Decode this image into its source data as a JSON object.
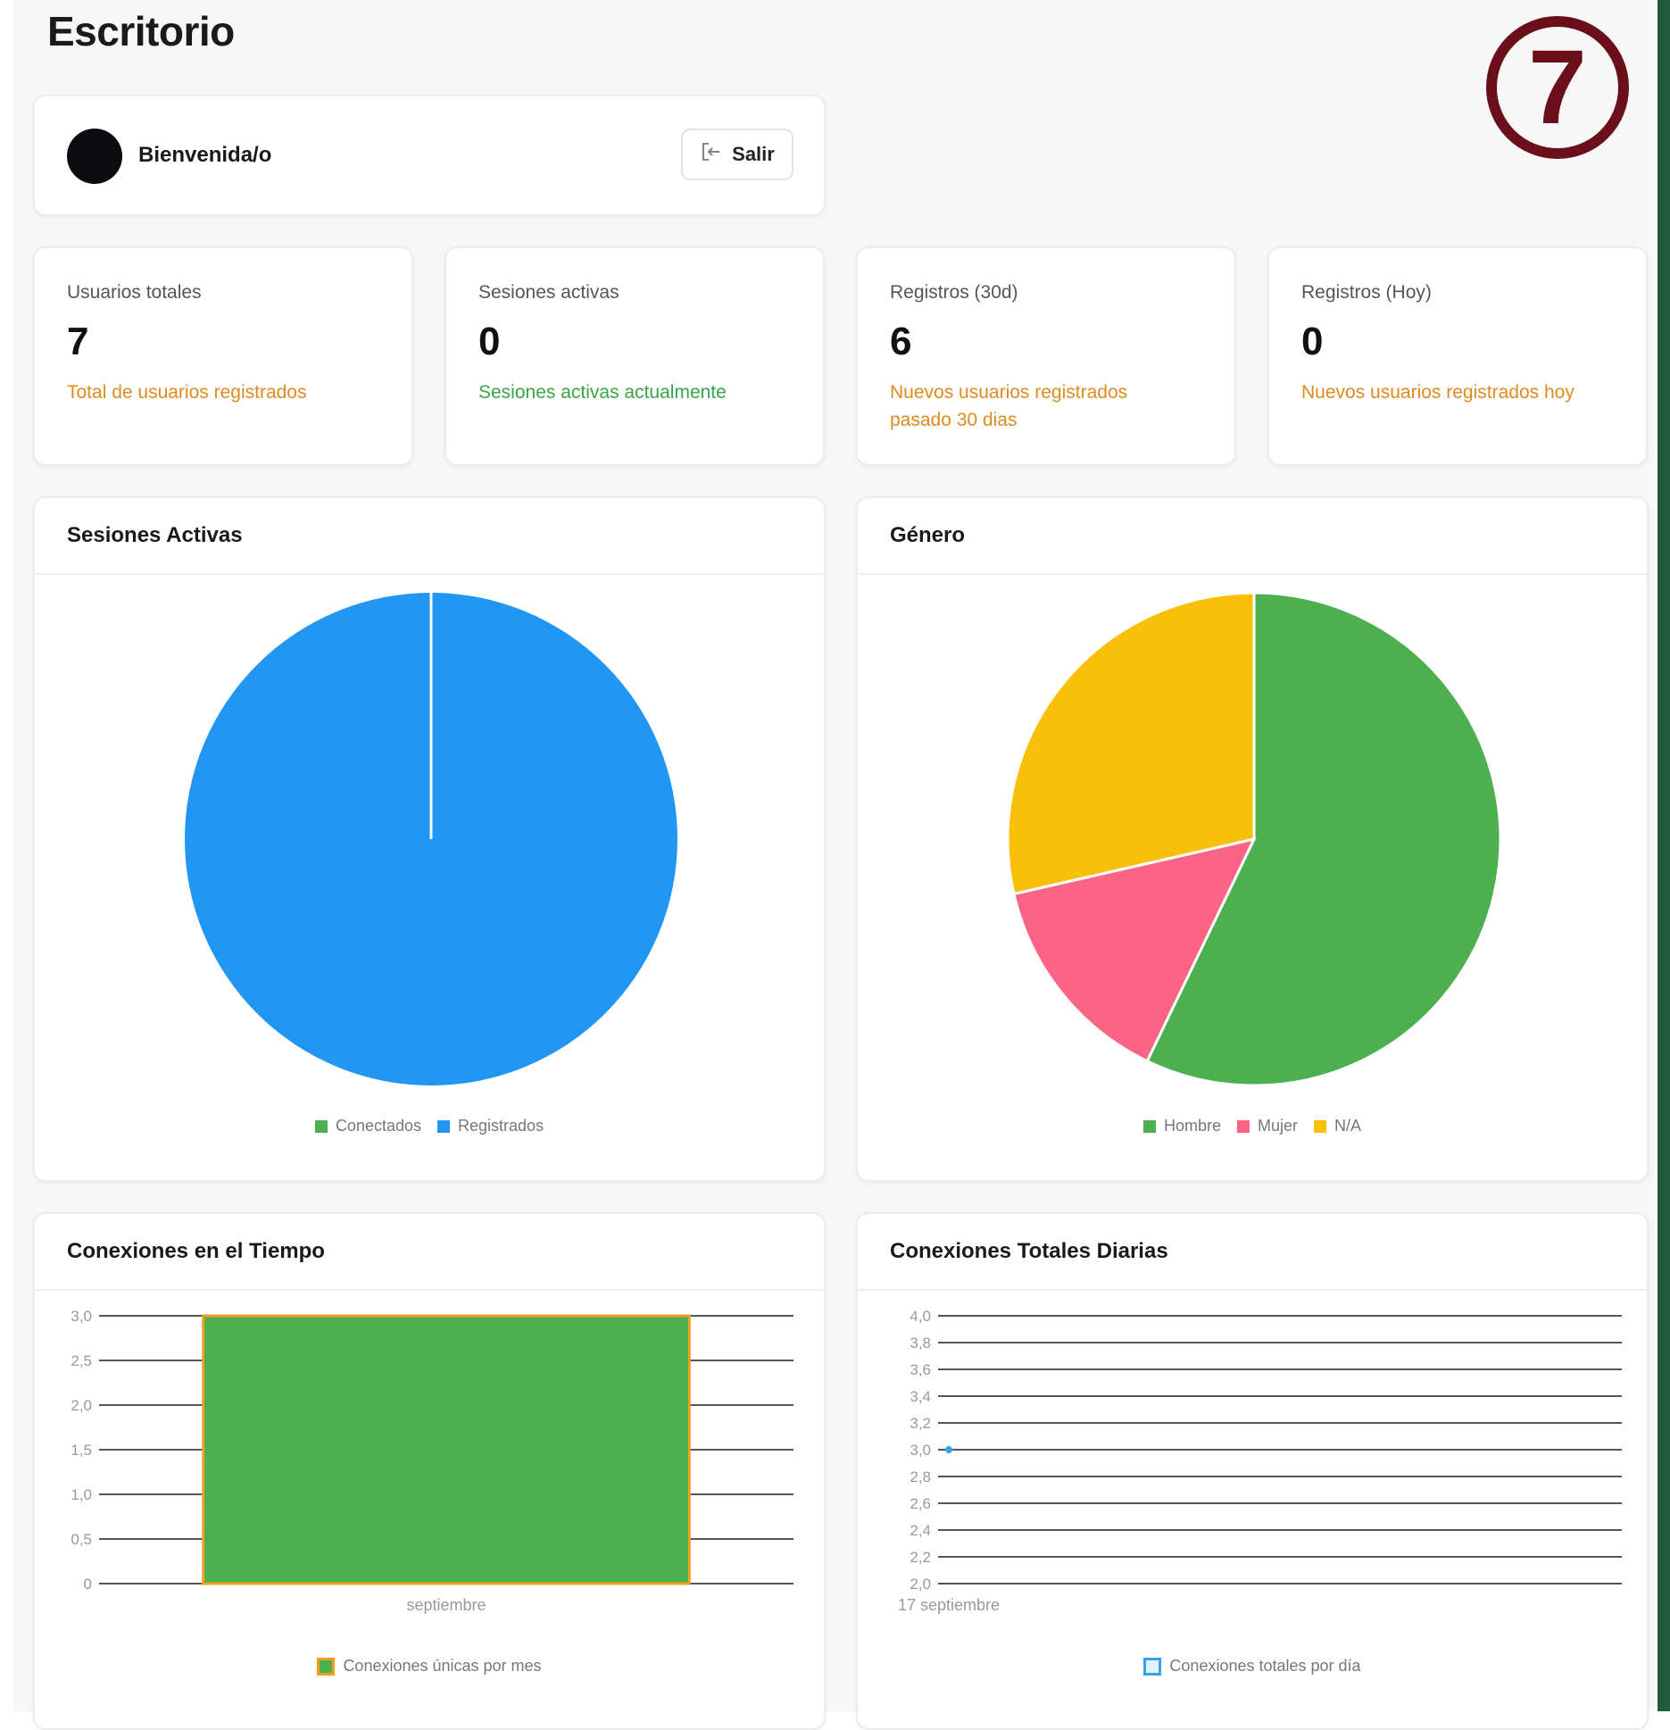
{
  "page": {
    "title": "Escritorio",
    "badge": "7"
  },
  "welcome": {
    "greeting": "Bienvenida/o",
    "logout_label": "Salir"
  },
  "stats": [
    {
      "label": "Usuarios totales",
      "value": "7",
      "subtitle": "Total de usuarios registrados",
      "color": "#e08a1e"
    },
    {
      "label": "Sesiones activas",
      "value": "0",
      "subtitle": "Sesiones activas actualmente",
      "color": "#3aa34a"
    },
    {
      "label": "Registros (30d)",
      "value": "6",
      "subtitle": "Nuevos usuarios registrados pasado 30 dias",
      "color": "#e08a1e"
    },
    {
      "label": "Registros (Hoy)",
      "value": "0",
      "subtitle": "Nuevos usuarios registrados hoy",
      "color": "#e08a1e"
    }
  ],
  "panels": {
    "sessions_title": "Sesiones Activas",
    "gender_title": "Género",
    "connections_title": "Conexiones en el Tiempo",
    "daily_title": "Conexiones Totales Diarias"
  },
  "chart_data": [
    {
      "type": "pie",
      "labels": [
        "Conectados",
        "Registrados"
      ],
      "values": [
        0,
        7
      ],
      "colors": [
        "#4caf50",
        "#2196f3"
      ]
    },
    {
      "type": "pie",
      "labels": [
        "Hombre",
        "Mujer",
        "N/A"
      ],
      "values": [
        4,
        1,
        2
      ],
      "colors": [
        "#4caf50",
        "#fc6384",
        "#f9bf09"
      ]
    },
    {
      "type": "bar",
      "categories": [
        "septiembre"
      ],
      "series": [
        {
          "name": "Conexiones únicas por mes",
          "values": [
            3
          ]
        }
      ],
      "ylim": [
        0,
        3
      ],
      "yticks": [
        "0",
        "0,5",
        "1,0",
        "1,5",
        "2,0",
        "2,5",
        "3,0"
      ],
      "bar_color": "#4caf50",
      "border_color": "#f0a01e",
      "grid": true
    },
    {
      "type": "line",
      "x": [
        "17 septiembre"
      ],
      "series": [
        {
          "name": "Conexiones totales por día",
          "values": [
            3
          ]
        }
      ],
      "ylim": [
        2,
        4
      ],
      "yticks": [
        "2,0",
        "2,2",
        "2,4",
        "2,6",
        "2,8",
        "3,0",
        "3,2",
        "3,4",
        "3,6",
        "3,8",
        "4,0"
      ],
      "point_color": "#36a2eb",
      "grid": true
    }
  ]
}
